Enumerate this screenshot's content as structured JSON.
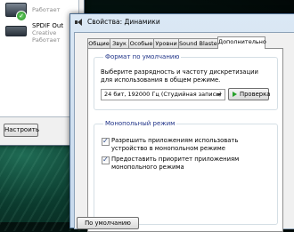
{
  "background_window": {
    "devices": [
      {
        "status": "Работает",
        "icon": "speaker-icon"
      },
      {
        "name": "SPDIF Out",
        "line2": "Creative",
        "status": "Работает",
        "icon": "monitor-icon"
      }
    ],
    "configure_button": "Настроить"
  },
  "dialog": {
    "title": "Свойства: Динамики",
    "tabs": [
      "Общие",
      "Звук",
      "Особые",
      "Уровни",
      "Sound Blaster",
      "Дополнительно"
    ],
    "active_tab": "Дополнительно",
    "default_format": {
      "heading": "Формат по умолчанию",
      "description": "Выберите разрядность и частоту дискретизации для использования в общем режиме.",
      "selected": "24 бит, 192000 Гц (Студийная запись)",
      "test_button": "Проверка"
    },
    "exclusive_mode": {
      "heading": "Монопольный режим",
      "option1": "Разрешить приложениям использовать устройство в монопольном режиме",
      "option1_checked": true,
      "option2": "Предоставить приоритет приложениям монопольного режима",
      "option2_checked": true
    },
    "defaults_button": "По умолчанию"
  }
}
